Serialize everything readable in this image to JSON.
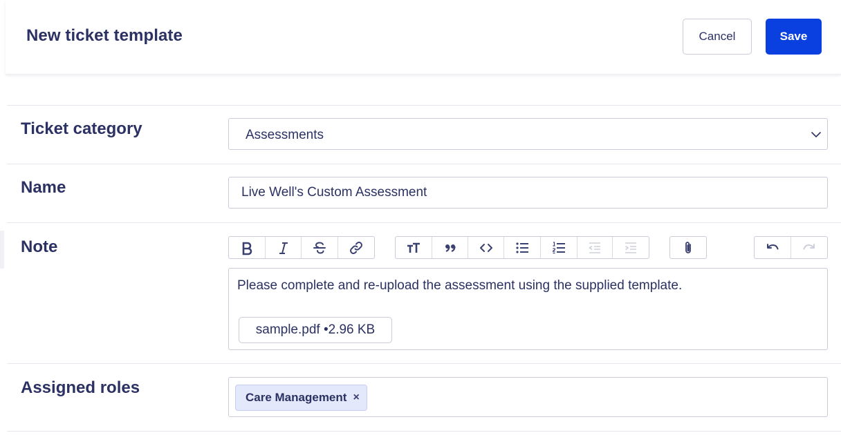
{
  "header": {
    "title": "New ticket template",
    "cancel_label": "Cancel",
    "save_label": "Save",
    "save_color": "#0a3fe0"
  },
  "form": {
    "category": {
      "label": "Ticket category",
      "value": "Assessments",
      "icon": "chevron-down-icon"
    },
    "name": {
      "label": "Name",
      "value": "Live Well's Custom Assessment"
    },
    "note": {
      "label": "Note",
      "toolbar": {
        "formatting": [
          "bold-icon",
          "italic-icon",
          "strikethrough-icon",
          "link-icon"
        ],
        "blocks": [
          "heading-icon",
          "quote-icon",
          "code-icon",
          "bullet-list-icon",
          "numbered-list-icon",
          "outdent-icon",
          "indent-icon"
        ],
        "attach": [
          "attach-icon"
        ],
        "history": [
          "undo-icon",
          "redo-icon"
        ]
      },
      "content": "Please complete and re-upload the assessment using the supplied template.",
      "attachment": "sample.pdf •2.96 KB"
    },
    "roles": {
      "label": "Assigned roles",
      "chips": [
        {
          "label": "Care Management",
          "remove": "×"
        }
      ]
    }
  }
}
